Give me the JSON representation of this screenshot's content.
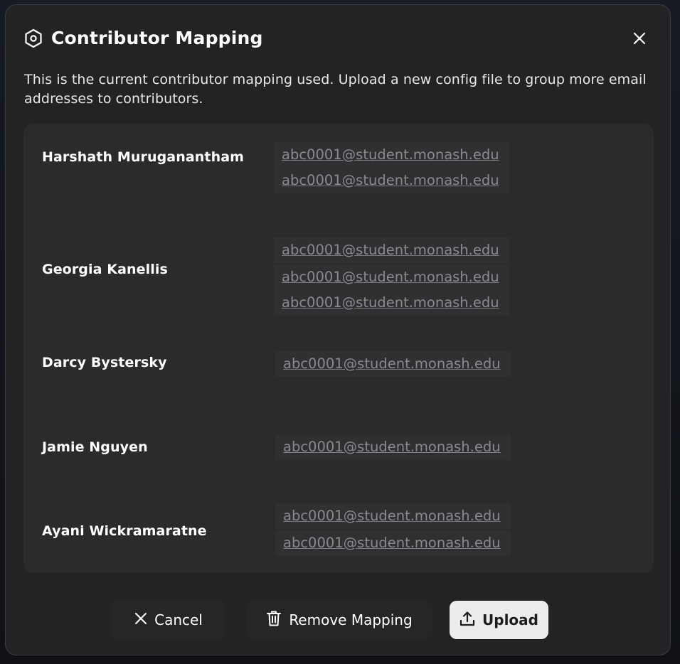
{
  "dialog": {
    "title": "Contributor Mapping",
    "description": "This is the current contributor mapping used. Upload a new config file to group more email addresses to contributors."
  },
  "contributors": [
    {
      "name": "Harshath Muruganantham",
      "emails": [
        "abc0001@student.monash.edu",
        "abc0001@student.monash.edu"
      ]
    },
    {
      "name": "Georgia Kanellis",
      "emails": [
        "abc0001@student.monash.edu",
        "abc0001@student.monash.edu",
        "abc0001@student.monash.edu"
      ]
    },
    {
      "name": "Darcy Bystersky",
      "emails": [
        "abc0001@student.monash.edu"
      ]
    },
    {
      "name": "Jamie Nguyen",
      "emails": [
        "abc0001@student.monash.edu"
      ]
    },
    {
      "name": "Ayani Wickramaratne",
      "emails": [
        "abc0001@student.monash.edu",
        "abc0001@student.monash.edu"
      ]
    }
  ],
  "footer": {
    "cancel_label": "Cancel",
    "remove_label": "Remove Mapping",
    "upload_label": "Upload"
  },
  "icons": {
    "title": "hexagon-settings-icon",
    "close": "close-icon",
    "cancel": "x-icon",
    "remove": "trash-icon",
    "upload": "upload-icon"
  },
  "colors": {
    "modal_bg": "#232325",
    "panel_bg": "#2b2b2d",
    "email_bg": "#303032",
    "upload_bg": "#ececec"
  }
}
